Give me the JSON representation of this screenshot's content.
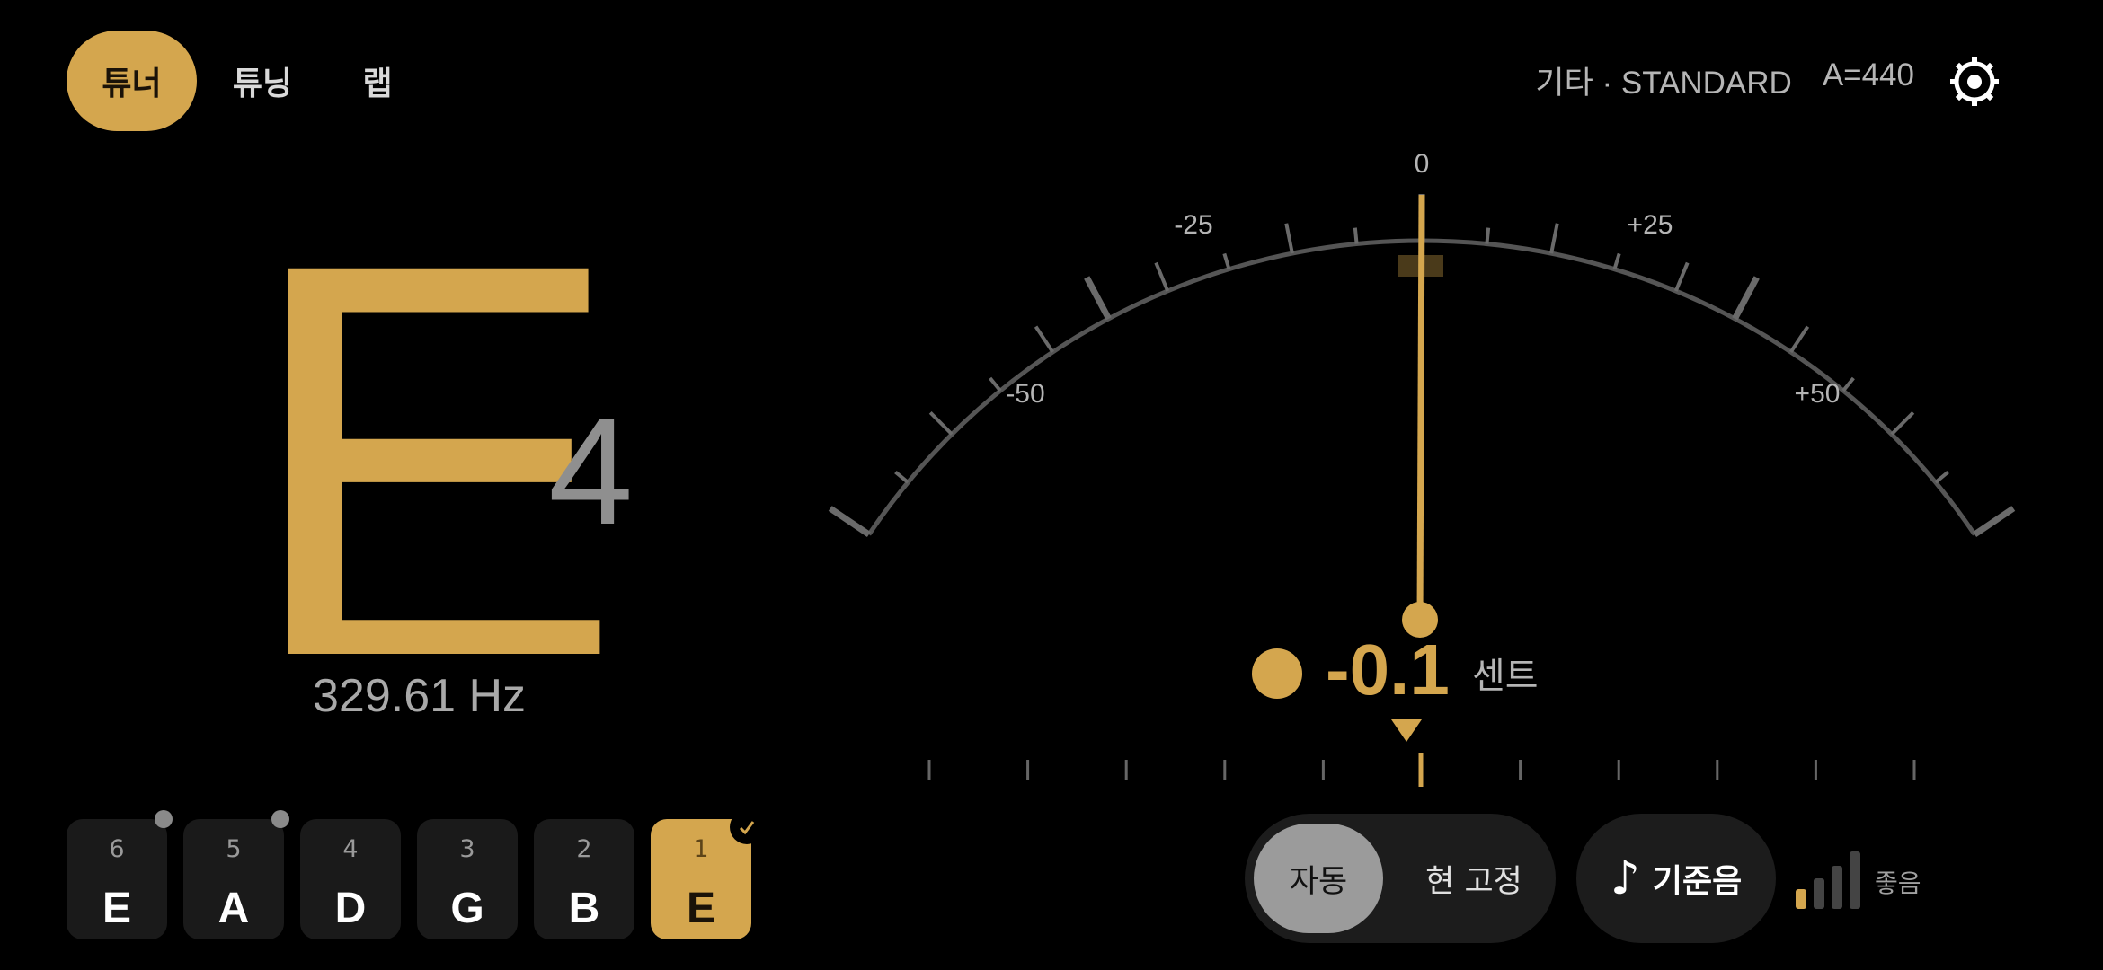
{
  "nav": {
    "tabs": [
      {
        "label": "튜너",
        "active": true
      },
      {
        "label": "튜닝",
        "active": false
      },
      {
        "label": "랩",
        "active": false
      }
    ]
  },
  "header": {
    "tuning_info": "기타 · STANDARD",
    "reference_pitch": "A=440",
    "settings_icon": "gear-icon"
  },
  "note": {
    "letter": "E",
    "octave": "4",
    "frequency": "329.61 Hz"
  },
  "gauge": {
    "labels": {
      "zero": "0",
      "minus25": "-25",
      "plus25": "+25",
      "minus50": "-50",
      "plus50": "+50"
    },
    "range": [
      -50,
      50
    ],
    "needle_cents": -0.1
  },
  "cents": {
    "value": "-0.1",
    "unit": "센트"
  },
  "strings": [
    {
      "number": "6",
      "note": "E",
      "status": "dot"
    },
    {
      "number": "5",
      "note": "A",
      "status": "dot"
    },
    {
      "number": "4",
      "note": "D",
      "status": "none"
    },
    {
      "number": "3",
      "note": "G",
      "status": "none"
    },
    {
      "number": "2",
      "note": "B",
      "status": "none"
    },
    {
      "number": "1",
      "note": "E",
      "status": "check",
      "active": true
    }
  ],
  "controls": {
    "mode_auto": "자동",
    "mode_fixed": "현 고정",
    "reference_tone": "기준음",
    "reference_icon": "♪",
    "signal_label": "좋음",
    "signal_level": 0.25
  },
  "colors": {
    "accent": "#D4A64E",
    "background": "#000000",
    "muted_text": "#b5b5b5"
  }
}
